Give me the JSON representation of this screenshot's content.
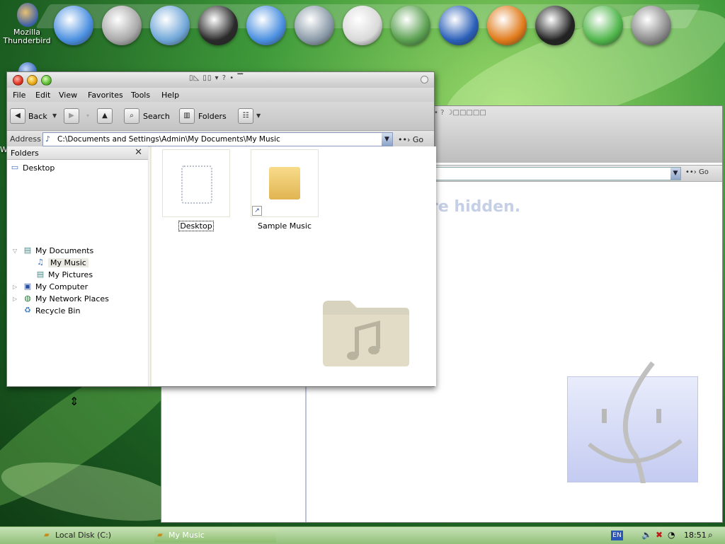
{
  "desktop": {
    "thunderbird_label": "Mozilla Thunderbird",
    "partial_label": "W"
  },
  "dock": {
    "icons": [
      {
        "name": "safari-compass-icon",
        "color": "#4a8fe0"
      },
      {
        "name": "trash-bin-icon",
        "color": "#a8a8a8"
      },
      {
        "name": "imac-display-icon",
        "color": "#6fa6d8"
      },
      {
        "name": "dashboard-gauge-icon",
        "color": "#2a2a2a"
      },
      {
        "name": "safari-browser-icon",
        "color": "#4a8fe0"
      },
      {
        "name": "network-drive-icon",
        "color": "#8a9aa8"
      },
      {
        "name": "speed-gauge-icon",
        "color": "#d9d9d9"
      },
      {
        "name": "imac-photo-icon",
        "color": "#5aa050"
      },
      {
        "name": "mail-globe-icon",
        "color": "#2a5fb8"
      },
      {
        "name": "firefox-icon",
        "color": "#e07a1a"
      },
      {
        "name": "terminal-icon",
        "color": "#222222"
      },
      {
        "name": "messenger-buddies-icon",
        "color": "#4fb64a"
      },
      {
        "name": "system-tools-icon",
        "color": "#8a8a8a"
      }
    ]
  },
  "back_window": {
    "title_fragment": "• ? ☽□□□□□",
    "go_label": "Go",
    "hidden_text": "re hidden."
  },
  "window": {
    "title_extra": "▯◺ ▯▯ ▾ ? • ▔",
    "menu": [
      "File",
      "Edit",
      "View",
      "Favorites",
      "Tools",
      "Help"
    ],
    "toolbar": {
      "back_label": "Back",
      "search_label": "Search",
      "folders_label": "Folders"
    },
    "address": {
      "label": "Address",
      "path": "C:\\Documents and Settings\\Admin\\My Documents\\My Music",
      "go_label": "Go"
    },
    "folders_pane": {
      "title": "Folders",
      "tree": [
        {
          "label": "Desktop",
          "icon": "desktop-icon"
        },
        {
          "label": "My Documents",
          "icon": "my-documents-icon"
        },
        {
          "label": "My Music",
          "icon": "my-music-icon"
        },
        {
          "label": "My Pictures",
          "icon": "my-pictures-icon"
        },
        {
          "label": "My Computer",
          "icon": "my-computer-icon"
        },
        {
          "label": "My Network Places",
          "icon": "network-places-icon"
        },
        {
          "label": "Recycle Bin",
          "icon": "recycle-bin-icon"
        }
      ]
    },
    "files": [
      {
        "label": "Desktop",
        "icon": "desktop-shortcut-icon"
      },
      {
        "label": "Sample Music",
        "icon": "folder-shortcut-icon"
      }
    ]
  },
  "taskbar": {
    "tasks": [
      "Local Disk (C:)",
      "My Music"
    ],
    "language": "EN",
    "clock": "18:51"
  }
}
